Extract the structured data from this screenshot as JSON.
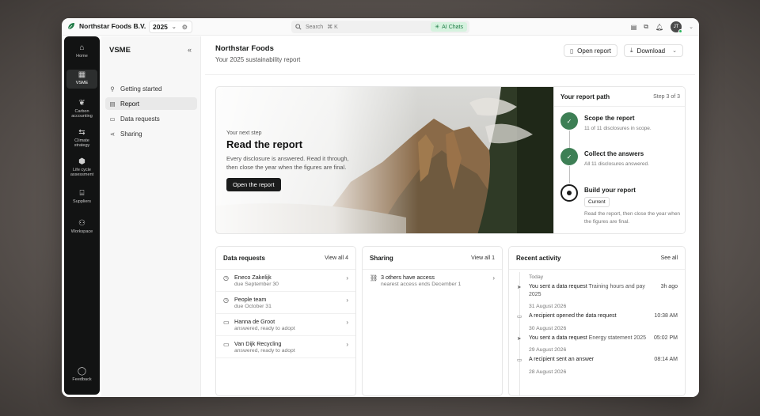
{
  "topbar": {
    "org_name": "Northstar Foods B.V.",
    "year": "2025",
    "search_placeholder": "Search",
    "search_shortcut": "⌘ K",
    "ai_chats_label": "AI Chats",
    "avatar_initials": "JT"
  },
  "rail": {
    "items": [
      {
        "label": "Home",
        "icon": "home-icon"
      },
      {
        "label": "VSME",
        "icon": "document-icon",
        "active": true
      },
      {
        "label": "Carbon accounting",
        "icon": "leaf-icon"
      },
      {
        "label": "Climate strategy",
        "icon": "route-icon"
      },
      {
        "label": "Life cycle assessment",
        "icon": "cube-icon"
      },
      {
        "label": "Suppliers",
        "icon": "store-icon"
      },
      {
        "label": "Workspace",
        "icon": "workspace-icon"
      }
    ],
    "feedback_label": "Feedback"
  },
  "sidebar": {
    "title": "VSME",
    "items": [
      {
        "label": "Getting started",
        "icon": "rocket-icon"
      },
      {
        "label": "Report",
        "icon": "file-icon",
        "active": true
      },
      {
        "label": "Data requests",
        "icon": "inbox-icon"
      },
      {
        "label": "Sharing",
        "icon": "share-icon"
      }
    ]
  },
  "main": {
    "title": "Northstar Foods",
    "subtitle": "Your 2025 sustainability report",
    "open_report_label": "Open report",
    "download_label": "Download"
  },
  "hero": {
    "kicker": "Your next step",
    "title": "Read the report",
    "description": "Every disclosure is answered. Read it through, then close the year when the figures are final.",
    "button_label": "Open the report"
  },
  "path": {
    "title": "Your report path",
    "step_counter": "Step 3 of 3",
    "steps": [
      {
        "title": "Scope the report",
        "desc": "11 of 11 disclosures in scope.",
        "status": "done"
      },
      {
        "title": "Collect the answers",
        "desc": "All 11 disclosures answered.",
        "status": "done"
      },
      {
        "title": "Build your report",
        "tag": "Current",
        "desc": "Read the report, then close the year when the figures are final.",
        "status": "current"
      }
    ]
  },
  "data_requests": {
    "title": "Data requests",
    "link": "View all 4",
    "rows": [
      {
        "name": "Eneco Zakelijk",
        "meta": "due September 30",
        "icon": "clock-icon"
      },
      {
        "name": "People team",
        "meta": "due October 31",
        "icon": "clock-icon"
      },
      {
        "name": "Hanna de Groot",
        "meta": "answered, ready to adopt",
        "icon": "inbox-icon"
      },
      {
        "name": "Van Dijk Recycling",
        "meta": "answered, ready to adopt",
        "icon": "inbox-icon"
      }
    ]
  },
  "sharing": {
    "title": "Sharing",
    "link": "View all 1",
    "rows": [
      {
        "name": "3 others have access",
        "meta": "nearest access ends December 1",
        "icon": "link-icon"
      }
    ]
  },
  "activity": {
    "title": "Recent activity",
    "link": "See all",
    "groups": [
      {
        "date": "Today",
        "items": [
          {
            "text": "You sent a data request",
            "detail": "Training hours and pay 2025",
            "time": "3h ago",
            "icon": "send-icon"
          }
        ]
      },
      {
        "date": "31 August 2026",
        "items": [
          {
            "text": "A recipient opened the data request",
            "detail": "",
            "time": "10:38 AM",
            "icon": "inbox-icon"
          }
        ]
      },
      {
        "date": "30 August 2026",
        "items": [
          {
            "text": "You sent a data request",
            "detail": "Energy statement 2025",
            "time": "05:02 PM",
            "icon": "send-icon"
          }
        ]
      },
      {
        "date": "29 August 2026",
        "items": [
          {
            "text": "A recipient sent an answer",
            "detail": "",
            "time": "08:14 AM",
            "icon": "inbox-icon"
          }
        ]
      },
      {
        "date": "28 August 2026",
        "items": []
      }
    ]
  }
}
